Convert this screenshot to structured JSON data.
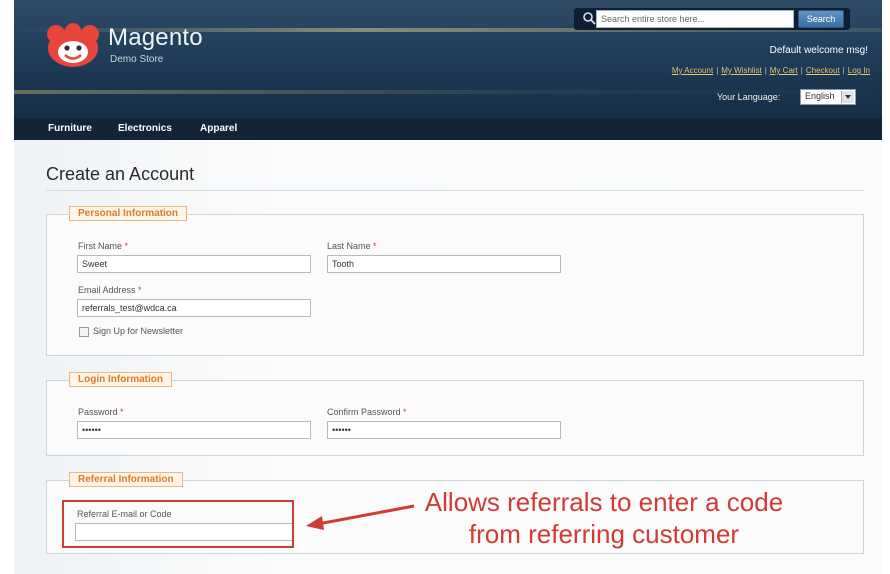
{
  "brand": {
    "name": "Magento",
    "subtitle": "Demo Store"
  },
  "search": {
    "placeholder": "Search entire store here...",
    "button_label": "Search"
  },
  "header": {
    "welcome": "Default welcome msg!",
    "links": [
      "My Account",
      "My Wishlist",
      "My Cart",
      "Checkout",
      "Log In"
    ],
    "language_label": "Your Language:",
    "language_value": "English"
  },
  "nav": {
    "items": [
      "Furniture",
      "Electronics",
      "Apparel"
    ]
  },
  "page": {
    "title": "Create an Account"
  },
  "personal": {
    "legend": "Personal Information",
    "first_name_label": "First Name",
    "first_name_value": "Sweet",
    "last_name_label": "Last Name",
    "last_name_value": "Tooth",
    "email_label": "Email Address",
    "email_value": "referrals_test@wdca.ca",
    "newsletter_label": "Sign Up for Newsletter",
    "required_mark": "*"
  },
  "login": {
    "legend": "Login Information",
    "password_label": "Password",
    "password_value": "••••••",
    "confirm_label": "Confirm Password",
    "confirm_value": "••••••"
  },
  "referral": {
    "legend": "Referral Information",
    "field_label": "Referral E-mail or Code",
    "field_value": ""
  },
  "annotation": {
    "text_line1": "Allows referrals to enter a code",
    "text_line2": "from referring customer",
    "color": "#d23a35"
  }
}
